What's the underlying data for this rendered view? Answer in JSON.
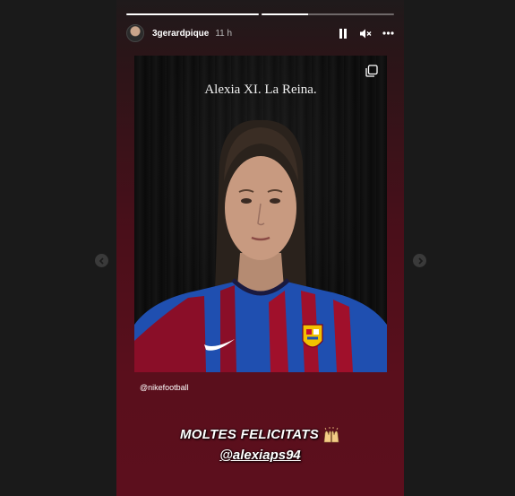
{
  "story": {
    "username": "3gerardpique",
    "time": "11 h",
    "progress": [
      1.0,
      0.35
    ],
    "photo_caption": "Alexia XI. La Reina.",
    "mention": "@nikefootball",
    "message": "MOLTES FELICITATS",
    "tag": "@alexiaps94"
  },
  "icons": {
    "pause": "pause-icon",
    "mute": "volume-muted-icon",
    "more": "more-options-icon",
    "multi": "multiple-images-icon",
    "prev": "chevron-left-icon",
    "next": "chevron-right-icon",
    "emoji": "raising-hands-emoji"
  },
  "colors": {
    "background": "#1a1a1a",
    "story_gradient_bottom": "#5c0f1d",
    "barca_blue": "#1f4fb0",
    "barca_red": "#a0102b"
  }
}
